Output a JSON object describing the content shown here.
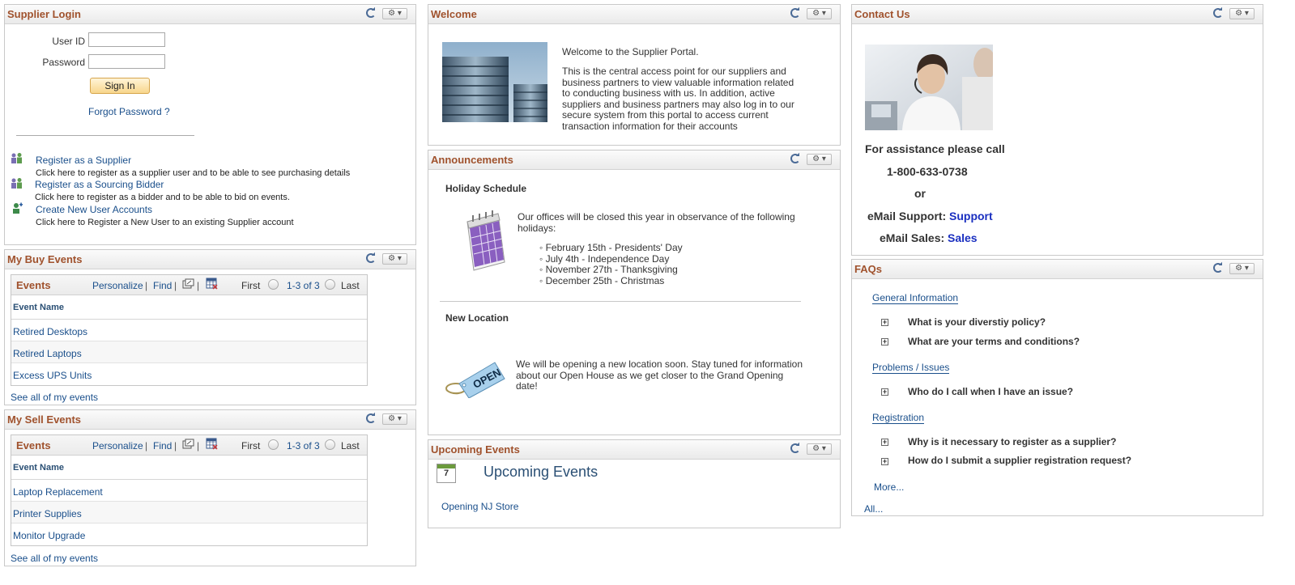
{
  "supplier_login": {
    "title": "Supplier Login",
    "user_id_label": "User ID",
    "password_label": "Password",
    "user_id_value": "",
    "password_value": "",
    "sign_in_label": "Sign In",
    "forgot_password": "Forgot Password ?",
    "links": [
      {
        "title": "Register as a Supplier",
        "desc": "Click here to register as a supplier user and to be able to see purchasing details"
      },
      {
        "title": "Register as a Sourcing Bidder",
        "desc": "Click here to register as a bidder and to be able to bid on events."
      },
      {
        "title": "Create New User Accounts",
        "desc": "Click here to Register a New User to an existing Supplier account"
      }
    ]
  },
  "my_buy_events": {
    "title": "My Buy Events",
    "grid_title": "Events",
    "personalize": "Personalize",
    "find": "Find",
    "first": "First",
    "range": "1-3 of 3",
    "last": "Last",
    "column": "Event Name",
    "rows": [
      "Retired Desktops",
      "Retired Laptops",
      "Excess UPS Units"
    ],
    "see_all": "See all of my events"
  },
  "my_sell_events": {
    "title": "My Sell Events",
    "grid_title": "Events",
    "personalize": "Personalize",
    "find": "Find",
    "first": "First",
    "range": "1-3 of 3",
    "last": "Last",
    "column": "Event Name",
    "rows": [
      "Laptop Replacement",
      "Printer Supplies",
      "Monitor Upgrade"
    ],
    "see_all": "See all of my events"
  },
  "welcome": {
    "title": "Welcome",
    "line1": "Welcome to the Supplier Portal.",
    "para": [
      "This is the central access point for our suppliers and",
      "business partners to view valuable information related",
      "to conducting business with us. In addition, active",
      "suppliers and business partners may also log in to our",
      "secure system from this portal to access current",
      "transaction information for their accounts"
    ]
  },
  "announcements": {
    "title": "Announcements",
    "holiday_heading": "Holiday Schedule",
    "holiday_intro": [
      "Our offices will be closed this year in observance of the following",
      "holidays:"
    ],
    "holidays": [
      "February 15th - Presidents' Day",
      "July 4th - Independence Day",
      "November 27th - Thanksgiving",
      "December 25th - Christmas"
    ],
    "location_heading": "New Location",
    "location_text": [
      "We will be opening a new location soon. Stay tuned for information",
      "about our Open House as we get closer to the Grand Opening",
      "date!"
    ],
    "open_sign": "OPEN"
  },
  "upcoming_events": {
    "title": "Upcoming Events",
    "heading": "Upcoming Events",
    "calendar_day": "7",
    "event": "Opening NJ Store"
  },
  "contact_us": {
    "title": "Contact Us",
    "assist": "For assistance please call",
    "phone": "1-800-633-0738",
    "or": "or",
    "support_label": "eMail Support:",
    "support_link": "Support",
    "sales_label": "eMail Sales:",
    "sales_link": "Sales"
  },
  "faqs": {
    "title": "FAQs",
    "sections": [
      {
        "name": "General Information",
        "questions": [
          "What is your diverstiy policy?",
          "What are your terms and conditions?"
        ]
      },
      {
        "name": "Problems / Issues",
        "questions": [
          "Who do I call when I have an issue?"
        ]
      },
      {
        "name": "Registration",
        "questions": [
          "Why is it necessary to register as a supplier?",
          "How do I submit a supplier registration request?"
        ]
      }
    ],
    "more": "More...",
    "all": "All..."
  }
}
